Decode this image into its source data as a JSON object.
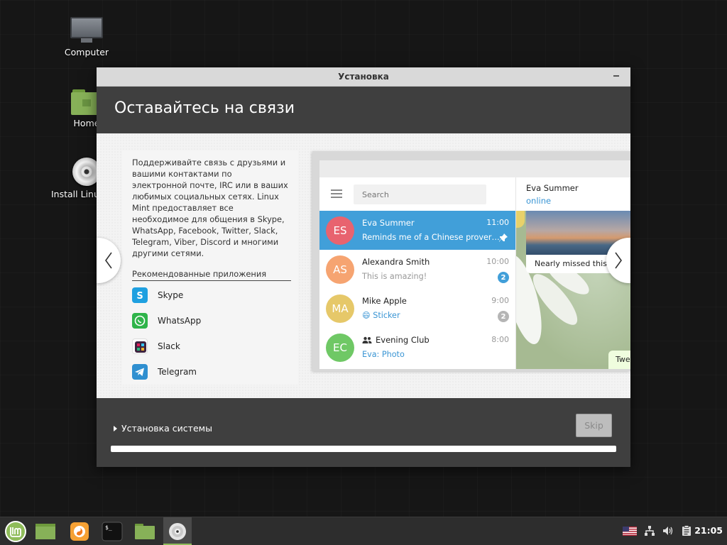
{
  "desktop": {
    "icons": [
      {
        "label": "Computer"
      },
      {
        "label": "Home"
      },
      {
        "label": "Install Linux Mint"
      }
    ]
  },
  "window": {
    "title": "Установка",
    "header_title": "Оставайтесь на связи",
    "description": "Поддерживайте связь с друзьями и вашими контактами по электронной почте, IRC или в ваших любимых социальных сетях. Linux Mint предоставляет все необходимое для общения в Skype, WhatsApp, Facebook, Twitter, Slack, Telegram, Viber, Discord и многими другими сетями.",
    "recommended_title": "Рекомендованные приложения",
    "apps": [
      {
        "name": "Skype",
        "icon": "skype-icon",
        "color": "#1fa0e0"
      },
      {
        "name": "WhatsApp",
        "icon": "whatsapp-icon",
        "color": "#2fb44a"
      },
      {
        "name": "Slack",
        "icon": "slack-icon",
        "color": "#3f2440"
      },
      {
        "name": "Telegram",
        "icon": "telegram-icon",
        "color": "#2f8fd0"
      }
    ],
    "footer_label": "Установка системы",
    "skip_label": "Skip"
  },
  "telegram": {
    "search_placeholder": "Search",
    "chats": [
      {
        "initials": "ES",
        "name": "Eva Summer",
        "time": "11:00",
        "message": "Reminds me of a Chinese prover…",
        "avatar_color": "#e8636f",
        "active": true,
        "pinned": true
      },
      {
        "initials": "AS",
        "name": "Alexandra Smith",
        "time": "10:00",
        "message": "This is amazing!",
        "avatar_color": "#f6a471",
        "badge": "2",
        "badge_color": "#419fd9"
      },
      {
        "initials": "MA",
        "name": "Mike Apple",
        "time": "9:00",
        "message": "Sticker",
        "message_prefix": "😄",
        "avatar_color": "#e6c869",
        "badge": "2",
        "badge_color": "#b5b5b5"
      },
      {
        "initials": "EC",
        "name": "Evening Club",
        "time": "8:00",
        "message": "Eva: Photo",
        "avatar_color": "#6fc865",
        "group": true
      }
    ],
    "chat_header": {
      "name": "Eva Summer",
      "status": "online"
    },
    "bubble1": "Nearly missed this sunrise",
    "bubble2": "Twe"
  },
  "taskbar": {
    "clock": "21:05",
    "accent": "#8fbc5a"
  }
}
